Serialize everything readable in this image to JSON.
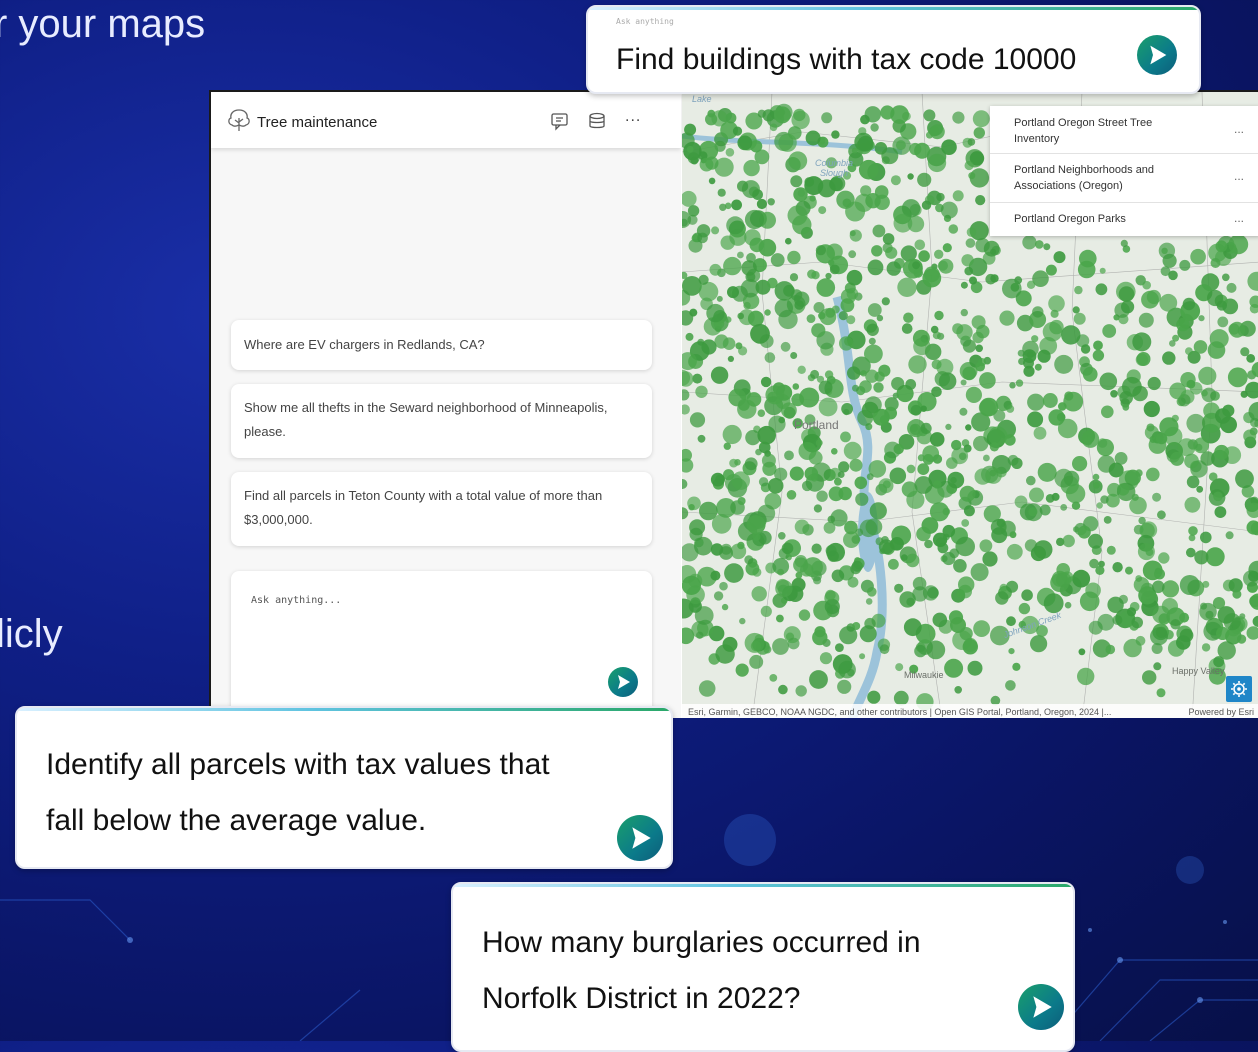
{
  "slide": {
    "heading_fragment": "r your maps",
    "side_fragment": "licly"
  },
  "chat": {
    "title": "Tree maintenance",
    "suggestions": [
      "Where are EV chargers in Redlands, CA?",
      "Show me all thefts in the Seward neighborhood of Minneapolis, please.",
      "Find all parcels in Teton County with a total value of more than $3,000,000."
    ],
    "input_placeholder": "Ask anything...",
    "more_label": "..."
  },
  "map": {
    "layers": [
      {
        "name": "Portland Oregon Street Tree Inventory"
      },
      {
        "name": "Portland Neighborhoods and Associations (Oregon)"
      },
      {
        "name": "Portland Oregon Parks"
      }
    ],
    "labels": {
      "lake": "Lake",
      "slough": "Columbia Slough",
      "portland": "Portland",
      "milwaukie": "Milwaukie",
      "happy_valley": "Happy Valley",
      "johnson_creek": "Johnson Creek"
    },
    "attribution": "Esri, Garmin, GEBCO, NOAA NGDC, and other contributors | Open GIS Portal, Portland, Oregon, 2024 |...",
    "powered_by": "Powered by Esri",
    "feature_color": "#4aa54a"
  },
  "bubbles": {
    "tax_code": {
      "text": "Find buildings with tax code 10000",
      "placeholder": "Ask anything"
    },
    "parcels": {
      "line1": "Identify all parcels with tax values that",
      "line2": "fall below the average value."
    },
    "burglaries": {
      "line1": "How many burglaries occurred in",
      "line2": "Norfolk District in 2022?"
    }
  }
}
